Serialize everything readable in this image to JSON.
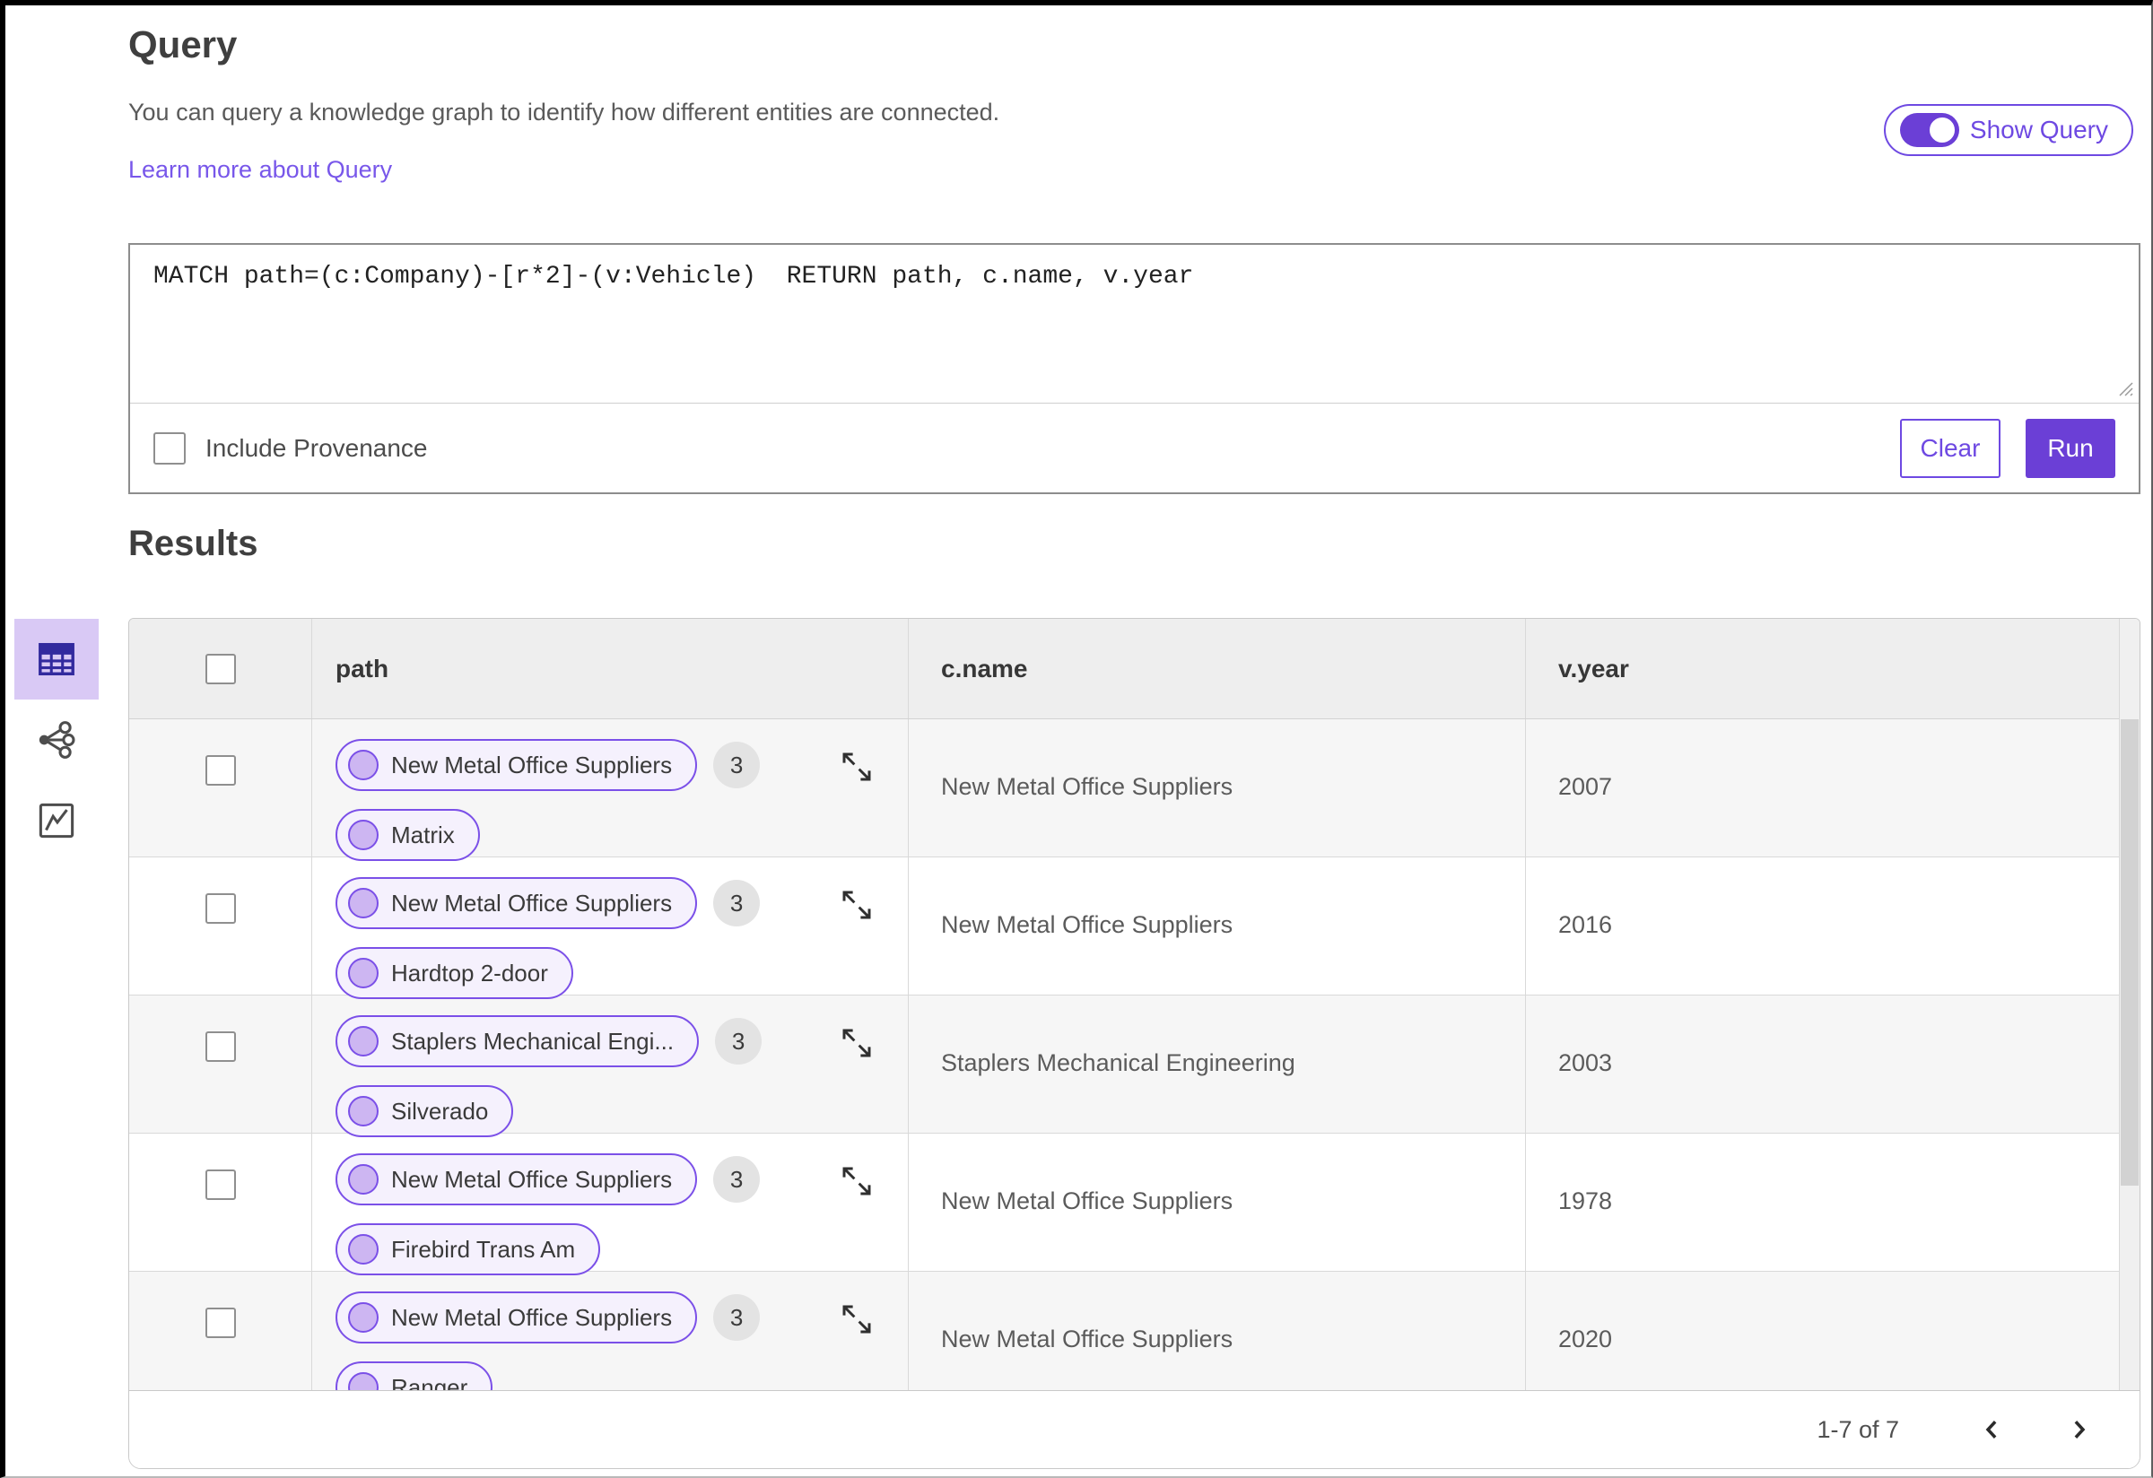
{
  "page": {
    "title": "Query",
    "description": "You can query a knowledge graph to identify how different entities are connected.",
    "learn_more": "Learn more about Query",
    "show_query_label": "Show Query",
    "show_query_on": true
  },
  "query_editor": {
    "text": "MATCH path=(c:Company)-[r*2]-(v:Vehicle)  RETURN path, c.name, v.year",
    "include_provenance_label": "Include Provenance",
    "include_provenance_checked": false,
    "clear_label": "Clear",
    "run_label": "Run"
  },
  "results": {
    "heading": "Results",
    "view_switcher_icons": [
      "table-view-icon",
      "network-graph-icon",
      "line-chart-icon"
    ],
    "selected_view": "table-view-icon",
    "columns": [
      "path",
      "c.name",
      "v.year"
    ],
    "rows": [
      {
        "path_nodes": [
          "New Metal Office Suppliers",
          "Matrix"
        ],
        "badge": "3",
        "c_name": "New Metal Office Suppliers",
        "v_year": "2007"
      },
      {
        "path_nodes": [
          "New Metal Office Suppliers",
          "Hardtop 2-door"
        ],
        "badge": "3",
        "c_name": "New Metal Office Suppliers",
        "v_year": "2016"
      },
      {
        "path_nodes": [
          "Staplers Mechanical Engi...",
          "Silverado"
        ],
        "badge": "3",
        "c_name": "Staplers Mechanical Engineering",
        "v_year": "2003"
      },
      {
        "path_nodes": [
          "New Metal Office Suppliers",
          "Firebird Trans Am"
        ],
        "badge": "3",
        "c_name": "New Metal Office Suppliers",
        "v_year": "1978"
      },
      {
        "path_nodes": [
          "New Metal Office Suppliers",
          "Ranger"
        ],
        "badge": "3",
        "c_name": "New Metal Office Suppliers",
        "v_year": "2020"
      }
    ],
    "pagination": {
      "label": "1-7 of 7",
      "icons": [
        "chevron-left-icon",
        "chevron-right-icon"
      ]
    }
  },
  "icons": {
    "row_expand": "expand-diagonal-icon",
    "textarea_corner": "resize-grip-icon",
    "node_marker": "node-dot-icon"
  },
  "colors": {
    "accent": "#6b3fd6",
    "accent2": "#6e49e2",
    "link": "#7857ea",
    "pill_border": "#7b50e8",
    "pill_bg": "#f5f1fd",
    "pill_dot": "#cdb6f2",
    "sel_bg": "#d9c9f5",
    "sel_icon": "#322a9e",
    "header_bg": "#eeeeee",
    "row_alt": "#f6f6f6",
    "tborder": "#c9c9c9",
    "divider": "#d9d9d9",
    "badge_bg": "#e3e3e3",
    "thumb": "#d2d2d2",
    "text_dark": "#3f3f3f",
    "text_mid": "#5a5a5a"
  }
}
